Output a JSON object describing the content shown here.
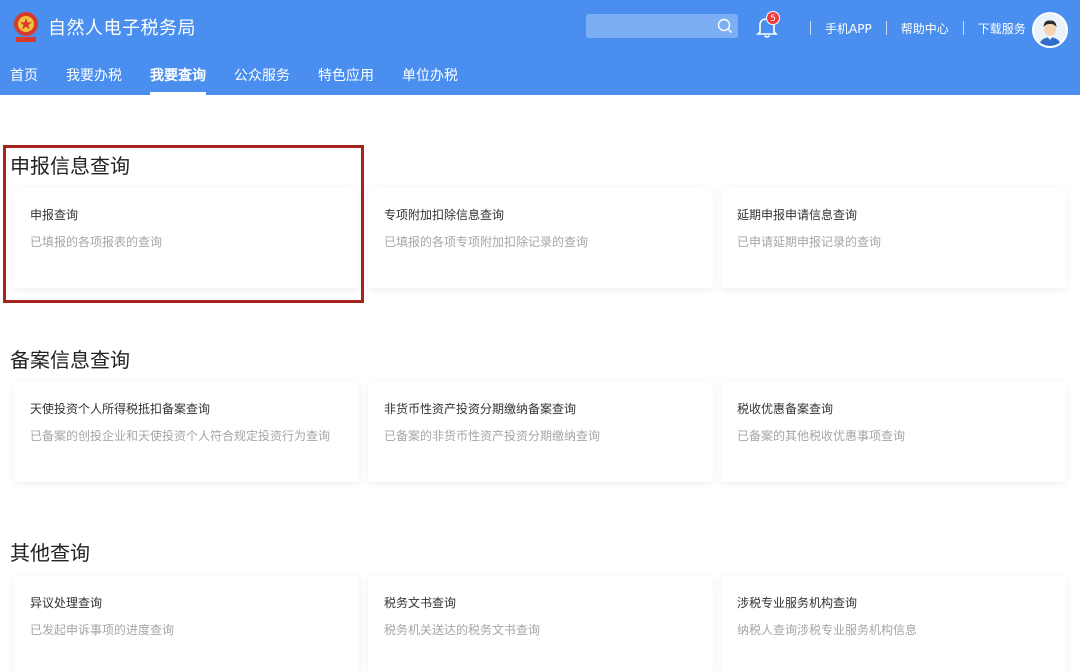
{
  "header": {
    "title": "自然人电子税务局",
    "emblem": "tax-bureau-emblem",
    "search": {
      "placeholder": "",
      "value": "",
      "icon": "search-icon"
    },
    "notifications": {
      "count": "5",
      "icon": "bell-icon"
    },
    "links": [
      "手机APP",
      "帮助中心",
      "下载服务"
    ],
    "colors": {
      "header_bg": "#4a8ff0",
      "badge": "#ee3b3b",
      "highlight": "#a8231c"
    }
  },
  "nav": {
    "items": [
      "首页",
      "我要办税",
      "我要查询",
      "公众服务",
      "特色应用",
      "单位办税"
    ],
    "active": "我要查询"
  },
  "sections": [
    {
      "title": "申报信息查询",
      "cards": [
        {
          "title": "申报查询",
          "desc": "已填报的各项报表的查询"
        },
        {
          "title": "专项附加扣除信息查询",
          "desc": "已填报的各项专项附加扣除记录的查询"
        },
        {
          "title": "延期申报申请信息查询",
          "desc": "已申请延期申报记录的查询"
        }
      ]
    },
    {
      "title": "备案信息查询",
      "cards": [
        {
          "title": "天使投资个人所得税抵扣备案查询",
          "desc": "已备案的创投企业和天使投资个人符合规定投资行为查询"
        },
        {
          "title": "非货币性资产投资分期缴纳备案查询",
          "desc": "已备案的非货币性资产投资分期缴纳查询"
        },
        {
          "title": "税收优惠备案查询",
          "desc": "已备案的其他税收优惠事项查询"
        }
      ]
    },
    {
      "title": "其他查询",
      "cards": [
        {
          "title": "异议处理查询",
          "desc": "已发起申诉事项的进度查询"
        },
        {
          "title": "税务文书查询",
          "desc": "税务机关送达的税务文书查询"
        },
        {
          "title": "涉税专业服务机构查询",
          "desc": "纳税人查询涉税专业服务机构信息"
        }
      ]
    }
  ]
}
